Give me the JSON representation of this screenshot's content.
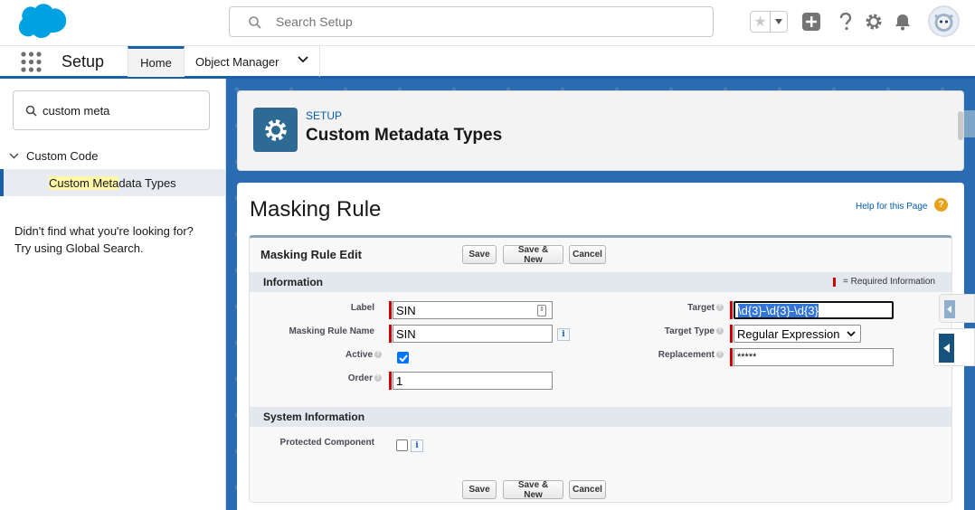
{
  "header": {
    "search_placeholder": "Search Setup"
  },
  "nav": {
    "app_name": "Setup",
    "tabs": [
      {
        "label": "Home"
      },
      {
        "label": "Object Manager"
      }
    ]
  },
  "sidebar": {
    "quickfind_value": "custom meta",
    "section_label": "Custom Code",
    "item_highlight": "Custom Meta",
    "item_rest": "data Types",
    "notfound_line1": "Didn't find what you're looking for?",
    "notfound_line2": "Try using Global Search."
  },
  "page_header": {
    "super": "SETUP",
    "title": "Custom Metadata Types"
  },
  "content": {
    "title": "Masking Rule",
    "help_link": "Help for this Page",
    "help_icon": "?",
    "edit_title": "Masking Rule Edit",
    "buttons": {
      "save": "Save",
      "save_new": "Save & New",
      "cancel": "Cancel"
    },
    "info_section": "Information",
    "required_legend": "= Required Information",
    "system_section": "System Information",
    "fields": {
      "label": {
        "label": "Label",
        "value": "SIN"
      },
      "masking_rule_name": {
        "label": "Masking Rule Name",
        "value": "SIN"
      },
      "active": {
        "label": "Active",
        "checked": true
      },
      "order": {
        "label": "Order",
        "value": "1"
      },
      "target": {
        "label": "Target",
        "value": "\\d{3}-\\d{3}-\\d{3}"
      },
      "target_type": {
        "label": "Target Type",
        "value": "Regular Expression"
      },
      "replacement": {
        "label": "Replacement",
        "value": "*****"
      },
      "protected_component": {
        "label": "Protected Component",
        "checked": false
      }
    },
    "info_glyph": "i"
  },
  "colors": {
    "brand_blue": "#1b5fa8",
    "setup_icon_bg": "#2e6b94",
    "required_red": "#cc0000",
    "main_bg": "#2a6cb1"
  }
}
